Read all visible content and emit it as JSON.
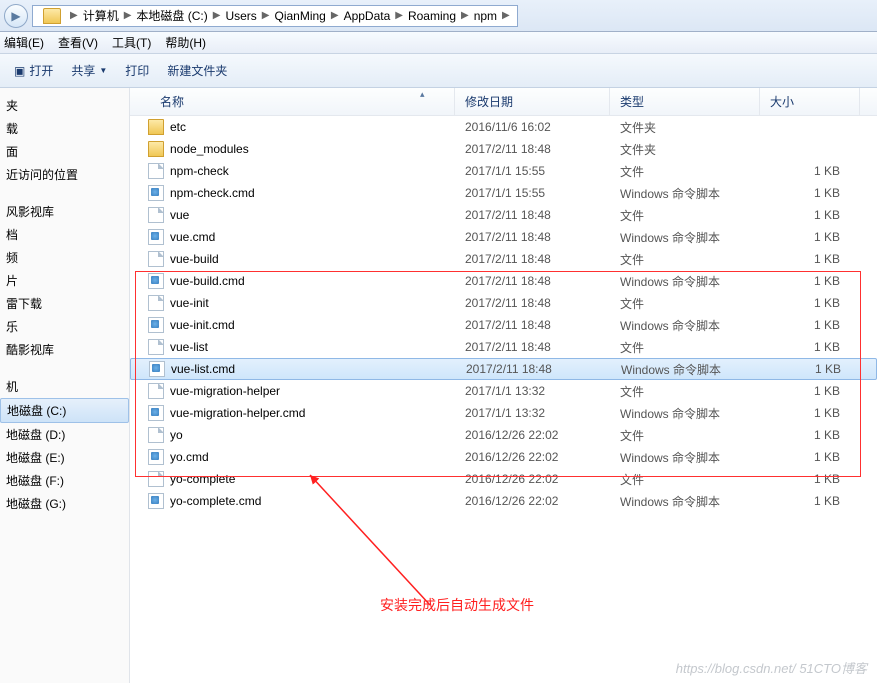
{
  "breadcrumb": [
    "计算机",
    "本地磁盘 (C:)",
    "Users",
    "QianMing",
    "AppData",
    "Roaming",
    "npm"
  ],
  "menu": {
    "edit": "编辑(E)",
    "view": "查看(V)",
    "tools": "工具(T)",
    "help": "帮助(H)"
  },
  "toolbar": {
    "open": "打开",
    "share": "共享",
    "print": "打印",
    "newfolder": "新建文件夹"
  },
  "columns": {
    "name": "名称",
    "date": "修改日期",
    "type": "类型",
    "size": "大小"
  },
  "sidebar": {
    "favorites": [
      "夹",
      "载",
      "面",
      "近访问的位置"
    ],
    "libraries": [
      "风影视库",
      "档",
      "频",
      "片",
      "雷下载",
      "乐",
      "酷影视库"
    ],
    "computer": "机",
    "drives": [
      "地磁盘 (C:)",
      "地磁盘 (D:)",
      "地磁盘 (E:)",
      "地磁盘 (F:)",
      "地磁盘 (G:)"
    ]
  },
  "files": [
    {
      "icon": "folder",
      "name": "etc",
      "date": "2016/11/6 16:02",
      "type": "文件夹",
      "size": ""
    },
    {
      "icon": "folder",
      "name": "node_modules",
      "date": "2017/2/11 18:48",
      "type": "文件夹",
      "size": ""
    },
    {
      "icon": "file",
      "name": "npm-check",
      "date": "2017/1/1 15:55",
      "type": "文件",
      "size": "1 KB"
    },
    {
      "icon": "cmd",
      "name": "npm-check.cmd",
      "date": "2017/1/1 15:55",
      "type": "Windows 命令脚本",
      "size": "1 KB"
    },
    {
      "icon": "file",
      "name": "vue",
      "date": "2017/2/11 18:48",
      "type": "文件",
      "size": "1 KB"
    },
    {
      "icon": "cmd",
      "name": "vue.cmd",
      "date": "2017/2/11 18:48",
      "type": "Windows 命令脚本",
      "size": "1 KB"
    },
    {
      "icon": "file",
      "name": "vue-build",
      "date": "2017/2/11 18:48",
      "type": "文件",
      "size": "1 KB"
    },
    {
      "icon": "cmd",
      "name": "vue-build.cmd",
      "date": "2017/2/11 18:48",
      "type": "Windows 命令脚本",
      "size": "1 KB"
    },
    {
      "icon": "file",
      "name": "vue-init",
      "date": "2017/2/11 18:48",
      "type": "文件",
      "size": "1 KB"
    },
    {
      "icon": "cmd",
      "name": "vue-init.cmd",
      "date": "2017/2/11 18:48",
      "type": "Windows 命令脚本",
      "size": "1 KB"
    },
    {
      "icon": "file",
      "name": "vue-list",
      "date": "2017/2/11 18:48",
      "type": "文件",
      "size": "1 KB"
    },
    {
      "icon": "cmd",
      "name": "vue-list.cmd",
      "date": "2017/2/11 18:48",
      "type": "Windows 命令脚本",
      "size": "1 KB",
      "selected": true
    },
    {
      "icon": "file",
      "name": "vue-migration-helper",
      "date": "2017/1/1 13:32",
      "type": "文件",
      "size": "1 KB"
    },
    {
      "icon": "cmd",
      "name": "vue-migration-helper.cmd",
      "date": "2017/1/1 13:32",
      "type": "Windows 命令脚本",
      "size": "1 KB"
    },
    {
      "icon": "file",
      "name": "yo",
      "date": "2016/12/26 22:02",
      "type": "文件",
      "size": "1 KB"
    },
    {
      "icon": "cmd",
      "name": "yo.cmd",
      "date": "2016/12/26 22:02",
      "type": "Windows 命令脚本",
      "size": "1 KB"
    },
    {
      "icon": "file",
      "name": "yo-complete",
      "date": "2016/12/26 22:02",
      "type": "文件",
      "size": "1 KB"
    },
    {
      "icon": "cmd",
      "name": "yo-complete.cmd",
      "date": "2016/12/26 22:02",
      "type": "Windows 命令脚本",
      "size": "1 KB"
    }
  ],
  "annotation": "安装完成后自动生成文件",
  "watermark": "https://blog.csdn.net/  51CTO博客"
}
